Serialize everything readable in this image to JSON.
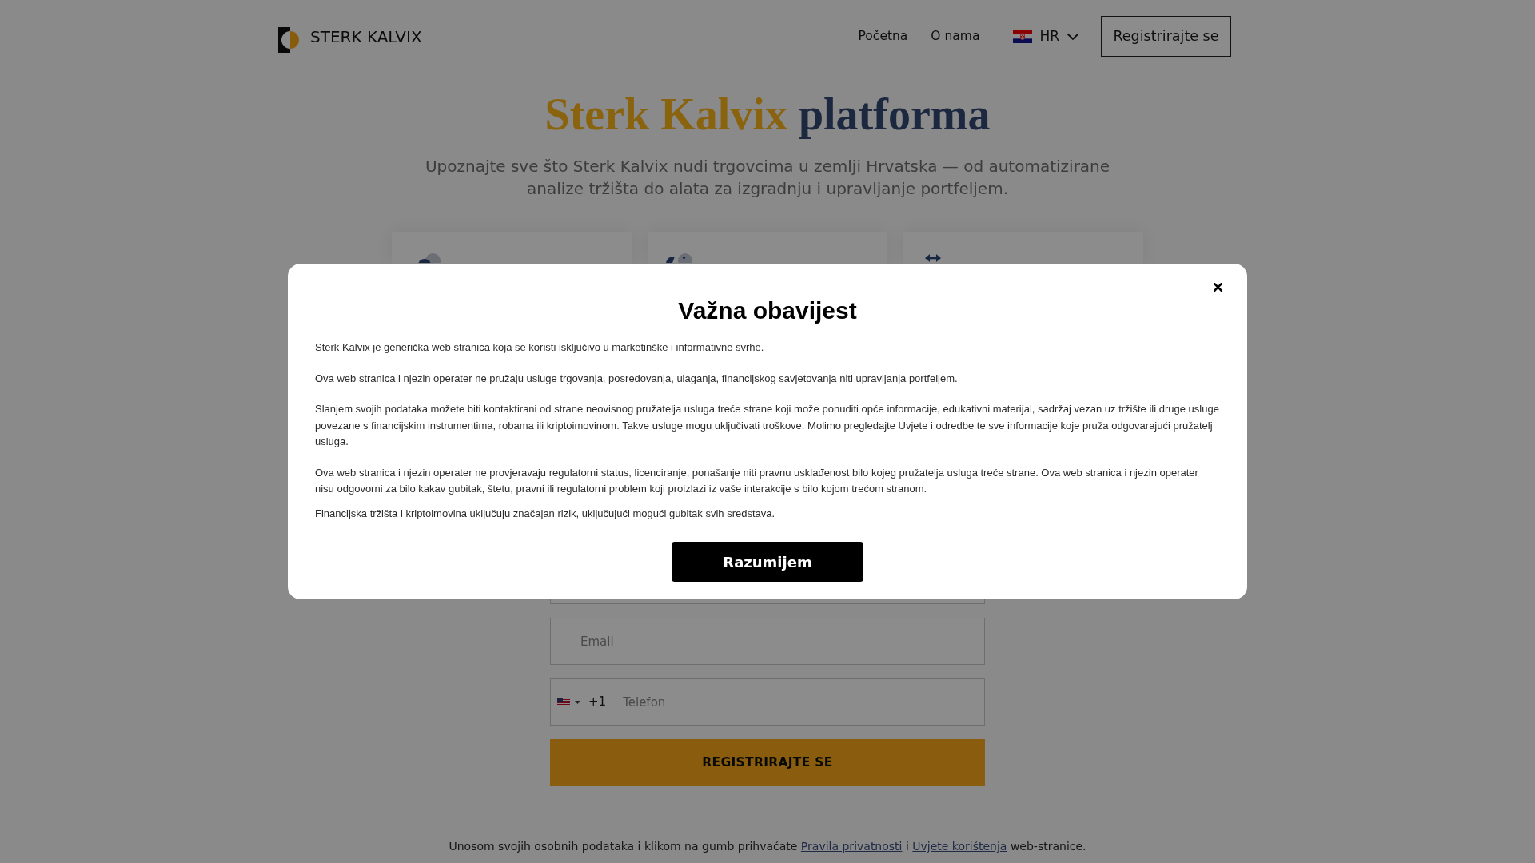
{
  "header": {
    "brand": "STERK KALVIX",
    "nav": [
      {
        "label": "Početna"
      },
      {
        "label": "O nama"
      }
    ],
    "language": {
      "code": "HR"
    },
    "register_button": "Registrirajte se"
  },
  "hero": {
    "title_highlight": "Sterk Kalvix",
    "title_rest": "platforma",
    "subtitle": "Upoznajte sve što Sterk Kalvix nudi trgovcima u zemlji Hrvatska — od automatizirane analize tržišta do alata za izgradnju i upravljanje portfeljem."
  },
  "signup_form": {
    "fields": [
      {
        "kind": "email",
        "placeholder": "Email"
      },
      {
        "kind": "phone",
        "dial_code": "+1",
        "placeholder": "Telefon"
      }
    ],
    "submit_button": "REGISTRIRAJTE SE"
  },
  "consent": [
    {
      "kind": "text",
      "text": "Unosom svojih osobnih podataka i klikom na gumb prihvaćate "
    },
    {
      "kind": "link",
      "text": "Pravila privatnosti"
    },
    {
      "kind": "text",
      "text": " i "
    },
    {
      "kind": "link",
      "text": "Uvjete korištenja"
    },
    {
      "kind": "text",
      "text": " web-stranice."
    }
  ],
  "notice_modal": {
    "title": "Važna obavijest",
    "paragraphs": [
      "Sterk Kalvix je generička web stranica koja se koristi isključivo u marketinške i informativne svrhe.",
      "Ova web stranica i njezin operater ne pružaju usluge trgovanja, posredovanja, ulaganja, financijskog savjetovanja niti upravljanja portfeljem.",
      "Slanjem svojih podataka možete biti kontaktirani od strane neovisnog pružatelja usluga treće strane koji može ponuditi opće informacije, edukativni materijal, sadržaj vezan uz tržište ili druge usluge povezane s financijskim instrumentima, robama ili kriptoimovinom. Takve usluge mogu uključivati troškove. Molimo pregledajte Uvjete i odredbe te sve informacije koje pruža odgovarajući pružatelj usluga.",
      "Ova web stranica i njezin operater ne provjeravaju regulatorni status, licenciranje, ponašanje niti pravnu usklađenost bilo kojeg pružatelja usluga treće strane. Ova web stranica i njezin operater nisu odgovorni za bilo kakav gubitak, štetu, pravni ili regulatorni problem koji proizlazi iz vaše interakcije s bilo kojom trećom stranom.",
      "Financijska tržišta i kriptoimovina uključuju značajan rizik, uključujući mogući gubitak svih sredstava."
    ],
    "confirm_button": "Razumijem"
  }
}
